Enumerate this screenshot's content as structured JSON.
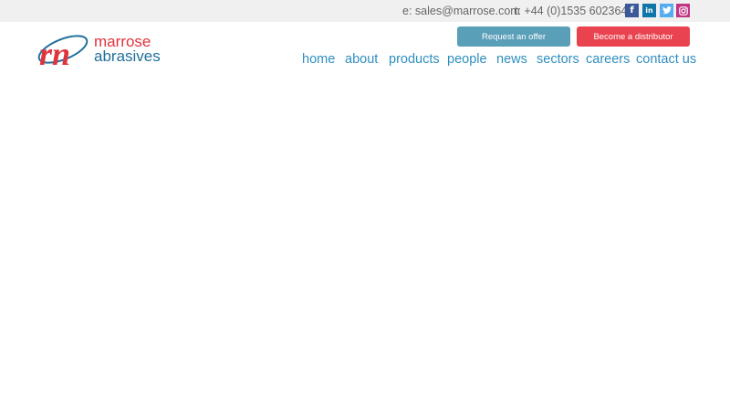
{
  "topbar": {
    "email": "e: sales@marrose.com",
    "phone": "t: +44 (0)1535 602364",
    "social": [
      {
        "icon": "facebook-icon",
        "glyph": "f",
        "color": "#3b5998"
      },
      {
        "icon": "linkedin-icon",
        "glyph": "in",
        "color": "#0e76a8"
      },
      {
        "icon": "twitter-icon",
        "glyph": "t",
        "color": "#55acee"
      },
      {
        "icon": "instagram-icon",
        "glyph": "◎",
        "color": "#c13584"
      }
    ]
  },
  "logo": {
    "line1": "marrose",
    "line2": "abrasives",
    "colors": {
      "red": "#e0333c",
      "blue": "#1f6f9c"
    }
  },
  "buttons": {
    "request_offer": "Request an offer",
    "become_distributor": "Become a distributor"
  },
  "nav": [
    "home",
    "about",
    "products",
    "people",
    "news",
    "sectors",
    "careers",
    "contact us"
  ],
  "colors": {
    "nav": "#2e8fc0",
    "offer_btn": "#5a9fb8",
    "distributor_btn": "#e8434f"
  }
}
